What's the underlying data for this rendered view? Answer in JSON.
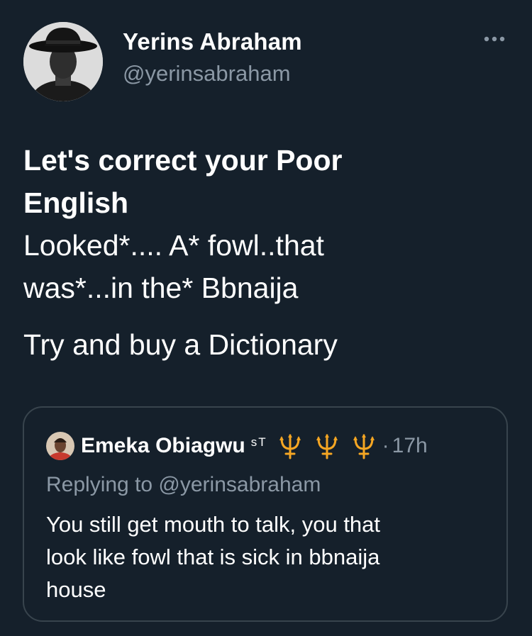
{
  "author": {
    "display_name": "Yerins Abraham",
    "handle": "@yerinsabraham"
  },
  "tweet": {
    "bold_lines": [
      "Let's correct your Poor",
      "English"
    ],
    "lines": [
      "Looked*.... A* fowl..that",
      "was*...in the* Bbnaija"
    ],
    "closing": "Try and buy a Dictionary"
  },
  "quote": {
    "display_name": "Emeka Obiagwu",
    "badge": "sT",
    "separator": "·",
    "time": "17h",
    "replying_to": "Replying to @yerinsabraham",
    "text_lines": [
      "You still get mouth to talk, you that",
      "look like fowl that is sick in bbnaija",
      "house"
    ]
  },
  "icons": {
    "more": "more-horizontal-icon",
    "trident": "trident-emoji-icon"
  },
  "colors": {
    "background": "#15202b",
    "text": "#ffffff",
    "secondary_text": "#8b98a5",
    "border": "#38444d",
    "trident": "#f5a623"
  }
}
